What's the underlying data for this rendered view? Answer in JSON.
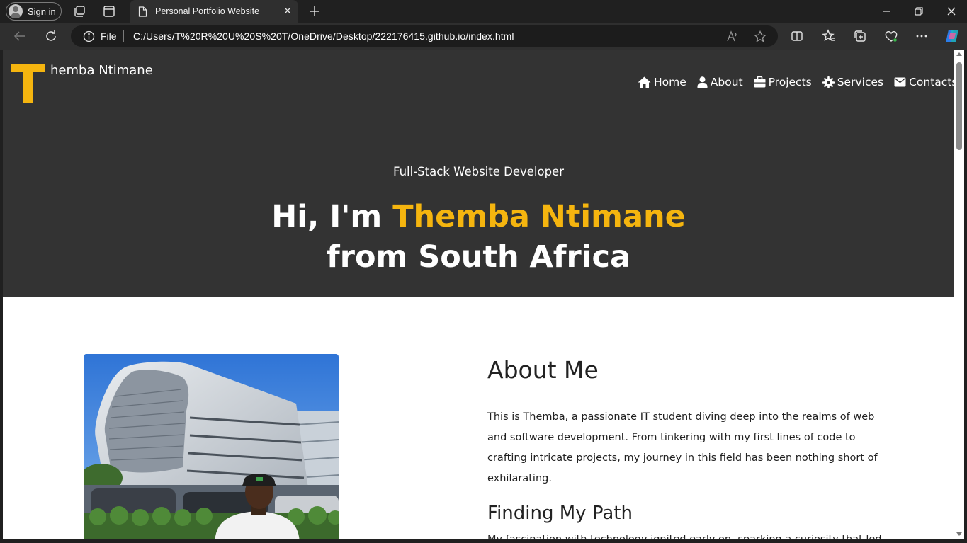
{
  "browser": {
    "signin_label": "Sign in",
    "tab_title": "Personal Portfolio Website",
    "address_prefix": "File",
    "url": "C:/Users/T%20R%20U%20S%20T/OneDrive/Desktop/222176415.github.io/index.html"
  },
  "site": {
    "logo_letter": "T",
    "logo_text": "hemba Ntimane",
    "nav": [
      {
        "label": "Home",
        "icon": "home-icon"
      },
      {
        "label": "About",
        "icon": "user-icon"
      },
      {
        "label": "Projects",
        "icon": "briefcase-icon"
      },
      {
        "label": "Services",
        "icon": "gear-icon"
      },
      {
        "label": "Contacts",
        "icon": "envelope-icon"
      }
    ],
    "tagline": "Full-Stack Website Developer",
    "headline_prefix": "Hi, I'm ",
    "headline_name": "Themba Ntimane",
    "headline_line2": "from South Africa"
  },
  "about": {
    "heading": "About Me",
    "intro": "This is Themba, a passionate IT student diving deep into the realms of web and software development. From tinkering with my first lines of code to crafting intricate projects, my journey in this field has been nothing short of exhilarating.",
    "subheading": "Finding My Path",
    "path_text": "My fascination with technology ignited early on, sparking a curiosity that led"
  },
  "colors": {
    "accent": "#f5b50f",
    "hero_bg": "#333333",
    "chrome_bg": "#202020"
  }
}
